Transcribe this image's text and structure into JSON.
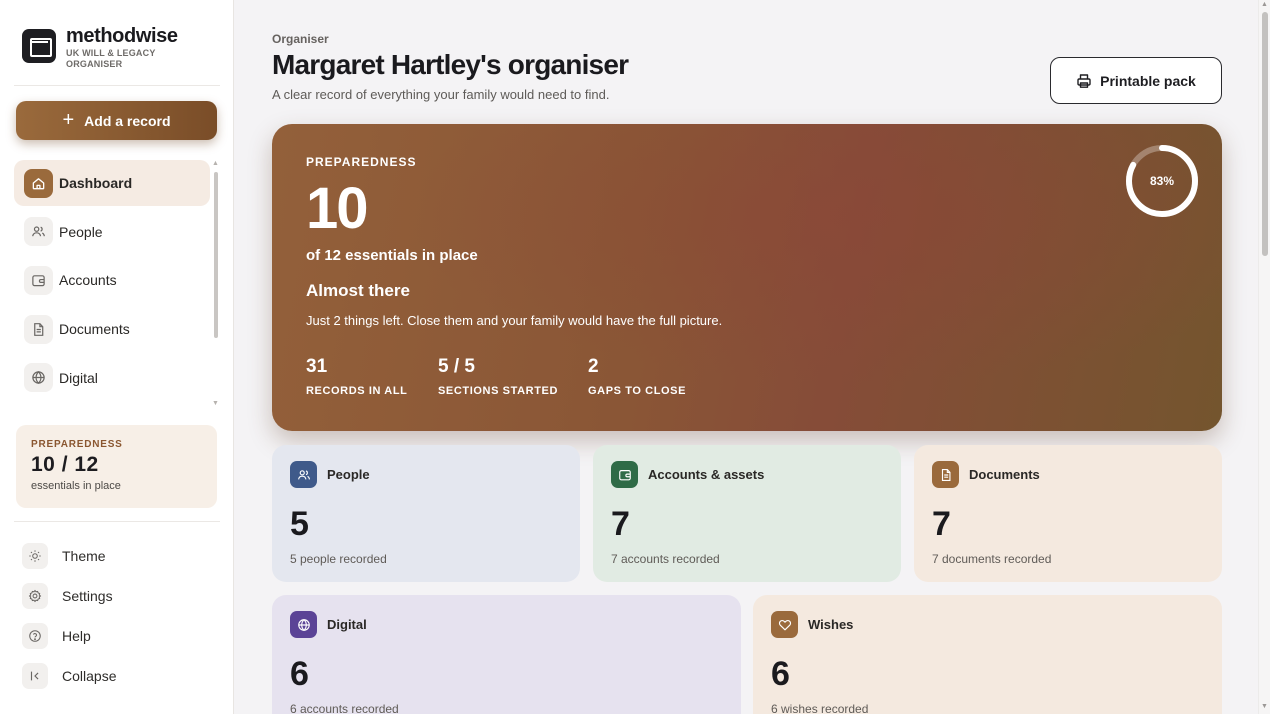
{
  "brand": {
    "name": "methodwise",
    "subtitle": "UK WILL & LEGACY ORGANISER"
  },
  "sidebar": {
    "add_label": "Add a record",
    "items": [
      {
        "label": "Dashboard",
        "icon": "home-icon",
        "active": true
      },
      {
        "label": "People",
        "icon": "people-icon"
      },
      {
        "label": "Accounts",
        "icon": "wallet-icon"
      },
      {
        "label": "Documents",
        "icon": "document-icon"
      },
      {
        "label": "Digital",
        "icon": "globe-icon"
      }
    ],
    "preparedness": {
      "label": "PREPAREDNESS",
      "value": "10 / 12",
      "sub": "essentials in place"
    },
    "bottom": [
      {
        "label": "Theme",
        "icon": "sun-icon"
      },
      {
        "label": "Settings",
        "icon": "gear-icon"
      },
      {
        "label": "Help",
        "icon": "help-icon"
      },
      {
        "label": "Collapse",
        "icon": "collapse-icon"
      }
    ]
  },
  "header": {
    "breadcrumb": "Organiser",
    "title": "Margaret Hartley's organiser",
    "subtitle": "A clear record of everything your family would need to find.",
    "print_label": "Printable pack"
  },
  "hero": {
    "label": "PREPAREDNESS",
    "number": "10",
    "of_text": "of 12 essentials in place",
    "status": "Almost there",
    "message": "Just 2 things left. Close them and your family would have the full picture.",
    "ring_label": "83%",
    "ring_fraction": 0.83,
    "stats": [
      {
        "value": "31",
        "label": "RECORDS IN ALL"
      },
      {
        "value": "5 / 5",
        "label": "SECTIONS STARTED"
      },
      {
        "value": "2",
        "label": "GAPS TO CLOSE"
      }
    ]
  },
  "cards": {
    "people": {
      "title": "People",
      "count": "5",
      "sub": "5 people recorded",
      "color": "#3f5a8a"
    },
    "accounts": {
      "title": "Accounts & assets",
      "count": "7",
      "sub": "7 accounts recorded",
      "color": "#2f6b47"
    },
    "documents": {
      "title": "Documents",
      "count": "7",
      "sub": "7 documents recorded",
      "color": "#9a6a3c"
    },
    "digital": {
      "title": "Digital",
      "count": "6",
      "sub": "6 accounts recorded",
      "color": "#5b4396"
    },
    "wishes": {
      "title": "Wishes",
      "count": "6",
      "sub": "6 wishes recorded",
      "color": "#9a6a3c"
    }
  },
  "colors": {
    "accent": "#9a6a3c",
    "hero_start": "#93603a",
    "hero_end": "#74552e"
  }
}
